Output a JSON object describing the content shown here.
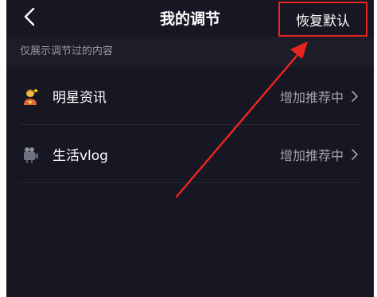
{
  "header": {
    "title": "我的调节",
    "back_icon": "chevron-left-icon",
    "reset_label": "恢复默认"
  },
  "section": {
    "label": "仅展示调节过的内容"
  },
  "items": [
    {
      "icon": "person-with-star-icon",
      "label": "明星资讯",
      "status": "增加推荐中"
    },
    {
      "icon": "video-camera-icon",
      "label": "生活vlog",
      "status": "增加推荐中"
    }
  ],
  "annotation": {
    "arrow_color": "#e8261d"
  },
  "colors": {
    "background": "#161722",
    "section_bg": "#1c1d29",
    "accent": "#e8261d"
  }
}
